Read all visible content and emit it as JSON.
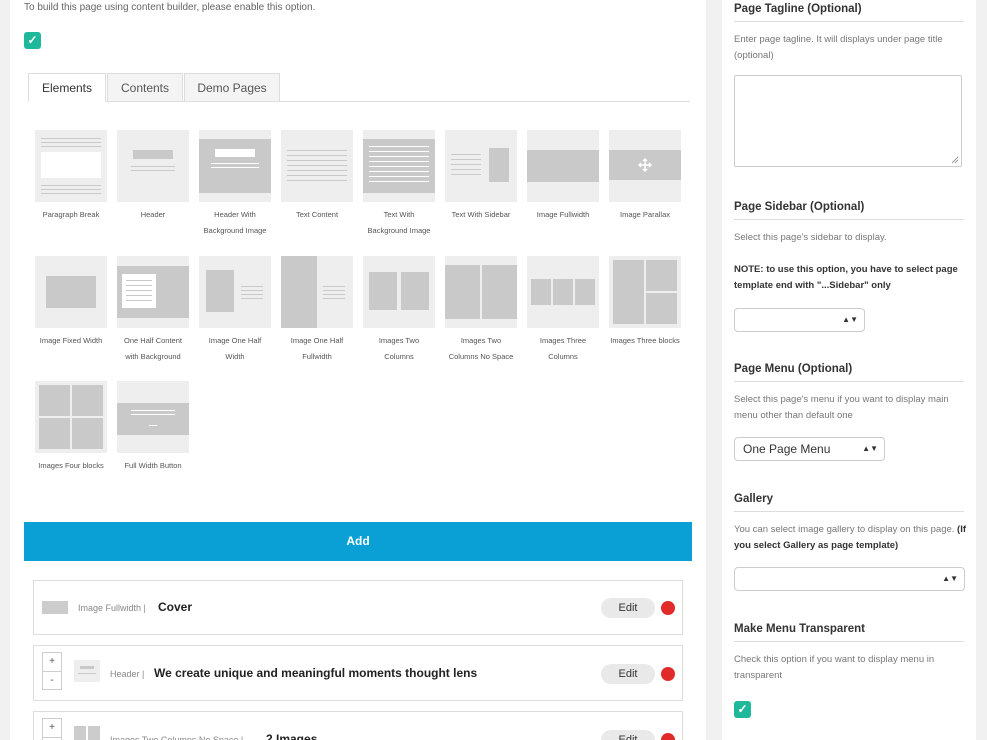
{
  "intro_text": "To build this page using content builder, please enable this option.",
  "checkmark": "✓",
  "tabs": [
    {
      "label": "Elements",
      "active": true
    },
    {
      "label": "Contents",
      "active": false
    },
    {
      "label": "Demo Pages",
      "active": false
    }
  ],
  "elements": [
    {
      "label_line1": "Paragraph Break",
      "label_line2": ""
    },
    {
      "label_line1": "Header",
      "label_line2": ""
    },
    {
      "label_line1": "Header With",
      "label_line2": "Background Image"
    },
    {
      "label_line1": "Text Content",
      "label_line2": ""
    },
    {
      "label_line1": "Text With",
      "label_line2": "Background Image"
    },
    {
      "label_line1": "Text With Sidebar",
      "label_line2": ""
    },
    {
      "label_line1": "Image Fullwidth",
      "label_line2": ""
    },
    {
      "label_line1": "Image Parallax",
      "label_line2": ""
    },
    {
      "label_line1": "Image Fixed Width",
      "label_line2": ""
    },
    {
      "label_line1": "One Half Content",
      "label_line2": "with Background"
    },
    {
      "label_line1": "Image One Half",
      "label_line2": "Width"
    },
    {
      "label_line1": "Image One Half",
      "label_line2": "Fullwidth"
    },
    {
      "label_line1": "Images Two",
      "label_line2": "Columns"
    },
    {
      "label_line1": "Images Two",
      "label_line2": "Columns No Space"
    },
    {
      "label_line1": "Images Three",
      "label_line2": "Columns"
    },
    {
      "label_line1": "Images Three blocks",
      "label_line2": ""
    },
    {
      "label_line1": "Images Four blocks",
      "label_line2": ""
    },
    {
      "label_line1": "Full Width Button",
      "label_line2": ""
    }
  ],
  "add_button": "Add",
  "content_rows": [
    {
      "type": "Image Fullwidth",
      "separator": "|",
      "title": "Cover",
      "edit": "Edit"
    },
    {
      "type": "Header",
      "separator": "|",
      "title": "We create unique and meaningful moments thought lens",
      "edit": "Edit"
    },
    {
      "type": "Images Two Columns No Space",
      "separator": "|",
      "title": "2 Images",
      "edit": "Edit"
    }
  ],
  "stepper": {
    "plus": "+",
    "minus": "-"
  },
  "sidebar": {
    "tagline": {
      "heading": "Page Tagline (Optional)",
      "desc": "Enter page tagline. It will displays under page title (optional)"
    },
    "page_sidebar": {
      "heading": "Page Sidebar (Optional)",
      "desc": "Select this page's sidebar to display.",
      "note": "NOTE: to use this option, you have to select page template end with \"...Sidebar\" only",
      "value": ""
    },
    "page_menu": {
      "heading": "Page Menu (Optional)",
      "desc": "Select this page's menu if you want to display main menu other than default one",
      "value": "One Page Menu"
    },
    "gallery": {
      "heading": "Gallery",
      "desc": "You can select image gallery to display on this page.",
      "desc_bold": "(If you select Gallery as page template)",
      "value": ""
    },
    "transparent": {
      "heading": "Make Menu Transparent",
      "desc": "Check this option if you want to display menu in transparent"
    }
  },
  "select_arrows": "▲▼",
  "colors": {
    "accent_blue": "#0aa0d6",
    "check_green": "#1fb89a",
    "delete_red": "#e12b2b"
  }
}
